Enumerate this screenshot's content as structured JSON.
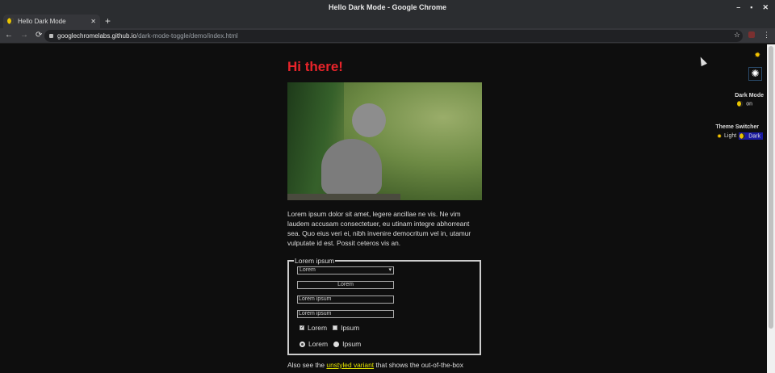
{
  "window": {
    "title": "Hello Dark Mode - Google Chrome",
    "controls": [
      "–",
      "▪",
      "✕"
    ]
  },
  "tab": {
    "label": "Hello Dark Mode",
    "close": "✕",
    "new_tab": "+"
  },
  "toolbar": {
    "back": "←",
    "forward": "→",
    "reload": "⟳",
    "url_host": "googlechromelabs.github.io",
    "url_path": "/dark-mode-toggle/demo/index.html",
    "star": "☆",
    "menu": "⋮"
  },
  "page": {
    "heading": "Hi there!",
    "paragraph": "Lorem ipsum dolor sit amet, legere ancillae ne vis. Ne vim laudem accusam consectetuer, eu utinam integre abhorreant sea. Quo eius veri ei, nibh invenire democritum vel in, utamur vulputate id est. Possit ceteros vis an.",
    "form": {
      "legend": "Lorem ipsum",
      "select_value": "Lorem",
      "button_label": "Lorem",
      "input1": "Lorem ipsum",
      "input2": "Lorem ipsum",
      "checkboxes": [
        {
          "label": "Lorem",
          "checked": true
        },
        {
          "label": "Ipsum",
          "checked": false
        }
      ],
      "radios": [
        {
          "label": "Lorem",
          "checked": true
        },
        {
          "label": "Ipsum",
          "checked": false
        }
      ]
    },
    "also_pre": "Also see the ",
    "also_link": "unstyled variant",
    "also_post": " that shows the out-of-the-box"
  },
  "side": {
    "dark_mode_label": "Dark Mode",
    "dark_mode_value": "on",
    "theme_switcher_label": "Theme Switcher",
    "light": "Light",
    "dark": "Dark"
  },
  "colors": {
    "heading": "#e8242a",
    "link": "#e6e600",
    "dark_selected": "#1a1aa0"
  }
}
